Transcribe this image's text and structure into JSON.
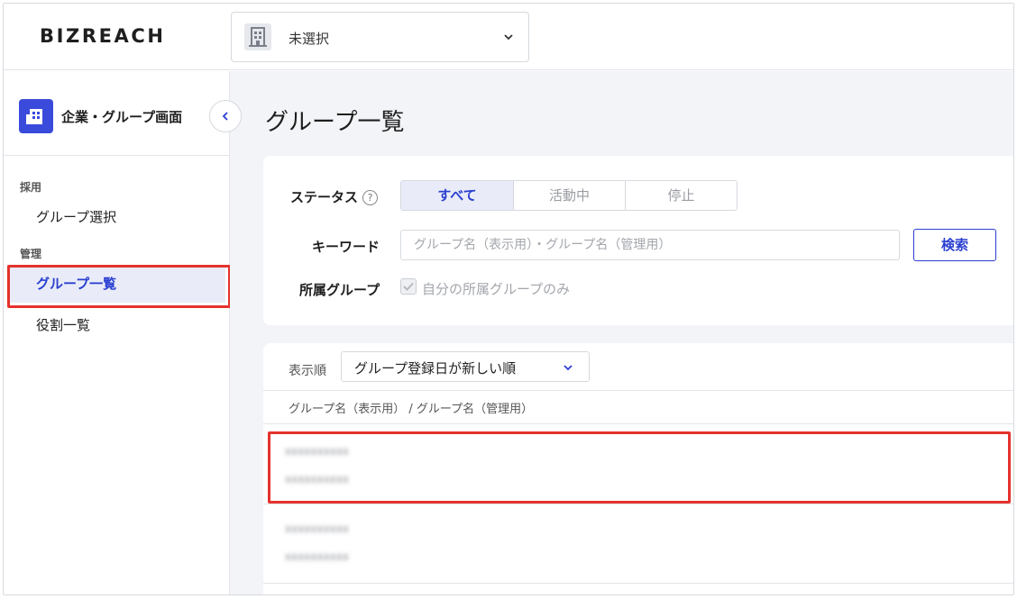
{
  "header": {
    "logo": "BIZREACH",
    "company_select": {
      "value": "未選択"
    }
  },
  "sidebar": {
    "title": "企業・グループ画面",
    "sections": [
      {
        "label": "採用",
        "items": [
          {
            "label": "グループ選択",
            "active": false
          }
        ]
      },
      {
        "label": "管理",
        "items": [
          {
            "label": "グループ一覧",
            "active": true
          },
          {
            "label": "役割一覧",
            "active": false
          }
        ]
      }
    ]
  },
  "main": {
    "title": "グループ一覧",
    "filter": {
      "status_label": "ステータス",
      "status_options": [
        "すべて",
        "活動中",
        "停止"
      ],
      "status_selected": "すべて",
      "keyword_label": "キーワード",
      "keyword_placeholder": "グループ名（表示用）・グループ名（管理用）",
      "keyword_value": "",
      "search_label": "検索",
      "affiliation_label": "所属グループ",
      "affiliation_checkbox_label": "自分の所属グループのみ",
      "affiliation_checked": true
    },
    "list": {
      "sort_label": "表示順",
      "sort_value": "グループ登録日が新しい順",
      "column_header": "グループ名（表示用） / グループ名（管理用）",
      "rows": [
        {
          "display_name": "xxxxxxxxxx",
          "admin_name": "xxxxxxxxxx"
        },
        {
          "display_name": "xxxxxxxxxx",
          "admin_name": "xxxxxxxxxx"
        }
      ]
    }
  },
  "colors": {
    "accent": "#2a3fd0",
    "highlight_border": "#e5322d",
    "active_bg": "#e9ecf8",
    "badge": "#3a4bdc"
  }
}
